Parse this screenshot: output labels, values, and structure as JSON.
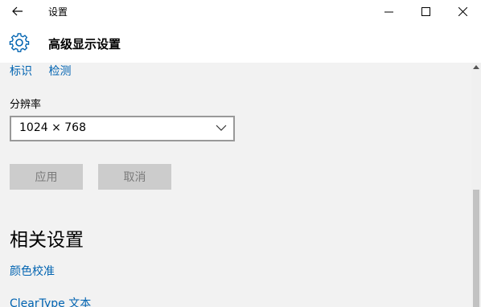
{
  "window": {
    "app_title": "设置",
    "back_icon": "back-arrow-icon",
    "minimize_icon": "minimize-icon",
    "maximize_icon": "maximize-icon",
    "close_icon": "close-icon"
  },
  "header": {
    "icon": "gear-icon",
    "title": "高级显示设置"
  },
  "main": {
    "links": [
      "标识",
      "检测"
    ],
    "resolution_label": "分辨率",
    "resolution_value": "1024 × 768",
    "apply_label": "应用",
    "cancel_label": "取消",
    "related_heading": "相关设置",
    "related_links": [
      "颜色校准",
      "ClearType 文本"
    ]
  },
  "colors": {
    "link": "#0063b1",
    "content_bg": "#f2f2f2",
    "disabled_button_bg": "#cccccc",
    "disabled_button_text": "#7a7a7a"
  }
}
